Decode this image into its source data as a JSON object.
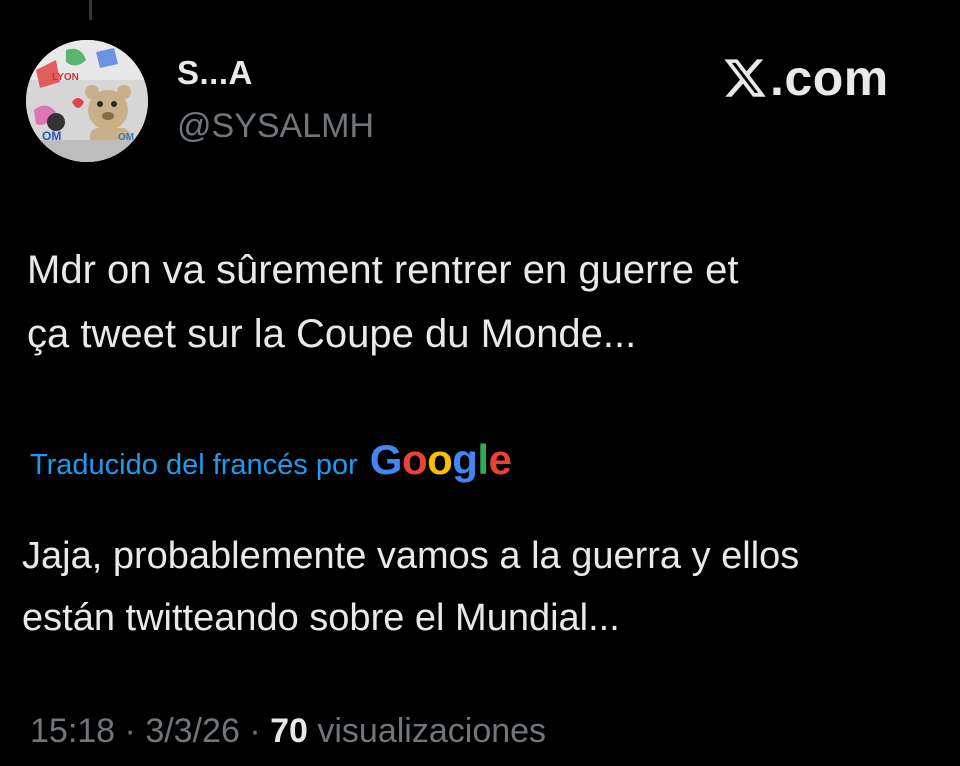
{
  "theme": {
    "background": "#000000",
    "text_primary": "#e7e9ea",
    "text_secondary": "#71767b",
    "link_blue": "#1d9bf0"
  },
  "author": {
    "display_name": "S...A",
    "handle": "@SYSALMH",
    "avatar_icon": "avatar-image"
  },
  "brand": {
    "icon": "x-logo-icon",
    "text": ".com"
  },
  "tweet": {
    "text": "Mdr on va sûrement rentrer en guerre et\nça tweet sur la Coupe du Monde..."
  },
  "translation": {
    "label": "Traducido del francés por",
    "provider_letters": [
      "G",
      "o",
      "o",
      "g",
      "l",
      "e"
    ],
    "provider_colors": [
      "#4285F4",
      "#EA4335",
      "#FBBC05",
      "#4285F4",
      "#34A853",
      "#EA4335"
    ],
    "text": "Jaja, probablemente vamos a la guerra y ellos\nestán twitteando sobre el Mundial..."
  },
  "meta": {
    "time": "15:18",
    "separator": "·",
    "date": "3/3/26",
    "views_count": "70",
    "views_label": "visualizaciones"
  }
}
